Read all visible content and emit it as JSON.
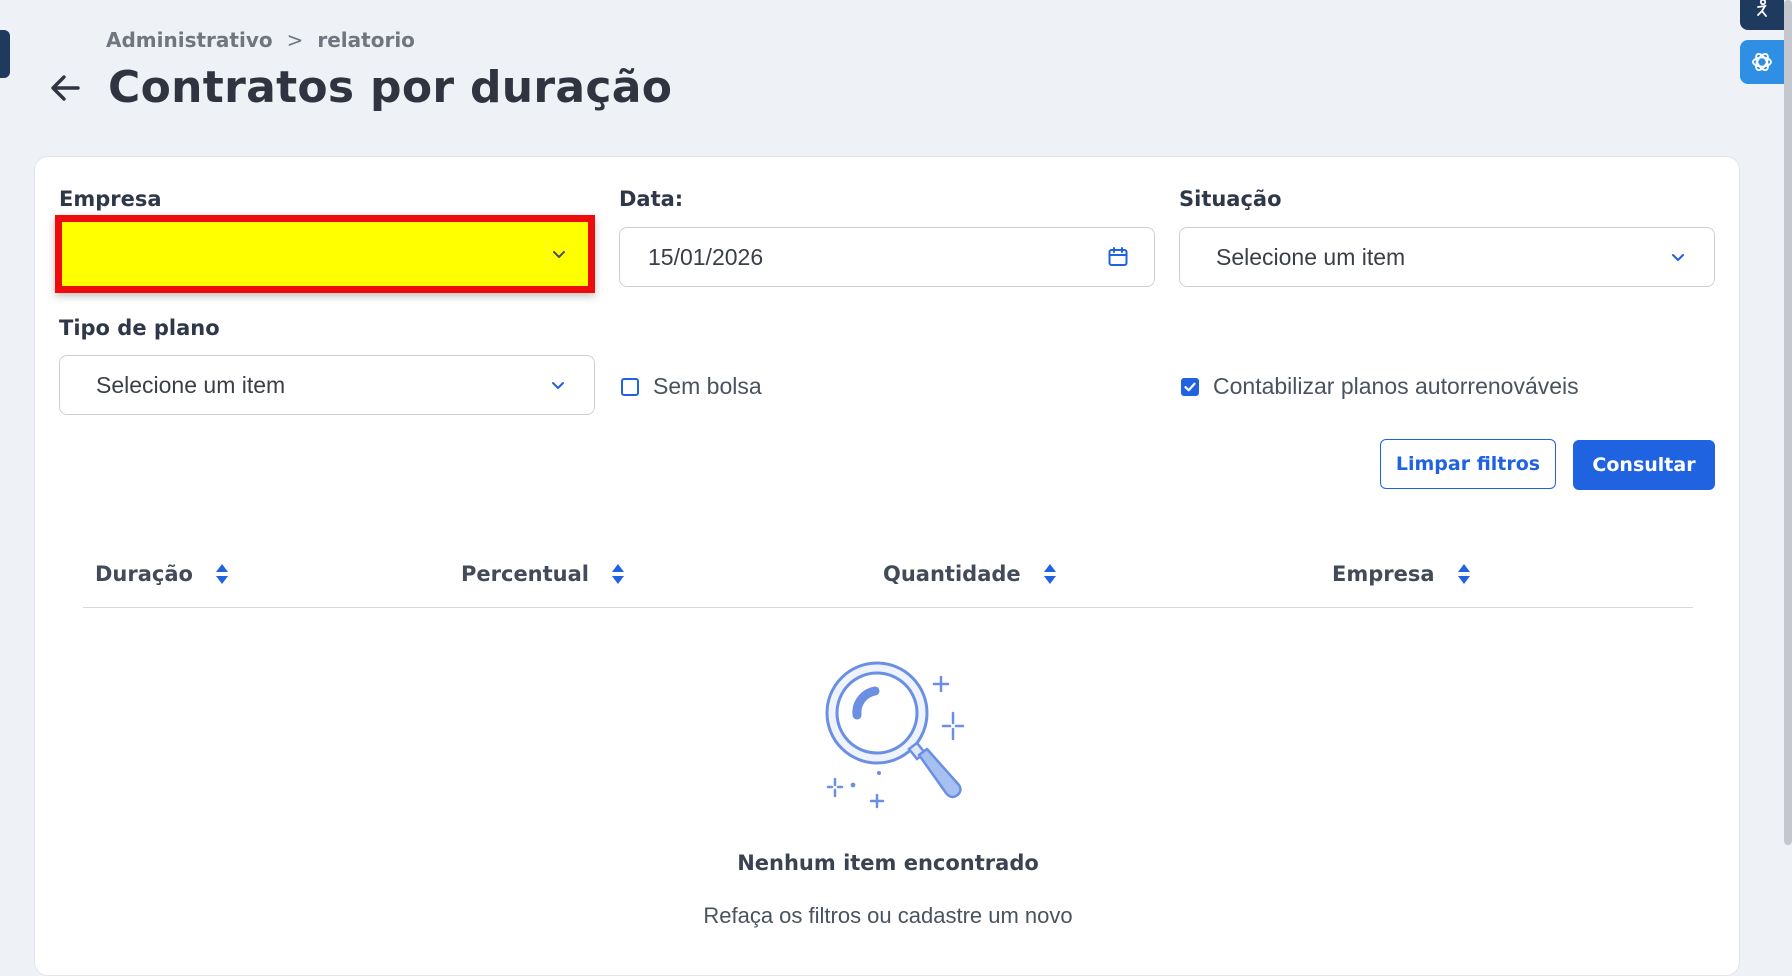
{
  "breadcrumb": {
    "items": [
      "Administrativo",
      "relatorio"
    ],
    "separator": ">"
  },
  "page": {
    "title": "Contratos por duração"
  },
  "filters": {
    "empresa": {
      "label": "Empresa",
      "value": ""
    },
    "data": {
      "label": "Data:",
      "value": "15/01/2026"
    },
    "situacao": {
      "label": "Situação",
      "value": "Selecione um item"
    },
    "tipo_plano": {
      "label": "Tipo de plano",
      "value": "Selecione um item"
    },
    "sem_bolsa": {
      "label": "Sem bolsa",
      "checked": false
    },
    "autorrenovaveis": {
      "label": "Contabilizar planos autorrenováveis",
      "checked": true
    }
  },
  "actions": {
    "clear_label": "Limpar filtros",
    "submit_label": "Consultar"
  },
  "table": {
    "columns": [
      "Duração",
      "Percentual",
      "Quantidade",
      "Empresa"
    ]
  },
  "empty_state": {
    "title": "Nenhum item encontrado",
    "subtitle": "Refaça os filtros ou cadastre um novo"
  },
  "colors": {
    "primary": "#1f63e0",
    "highlight_fill": "#ffff00",
    "highlight_border": "#ee0b0b",
    "background": "#eef1f5"
  },
  "icons": {
    "back": "arrow-left-icon",
    "calendar": "calendar-icon",
    "dropdown": "chevron-down-icon",
    "sort": "sort-icon",
    "empty": "magnifier-icon",
    "gpt": "openai-icon"
  }
}
